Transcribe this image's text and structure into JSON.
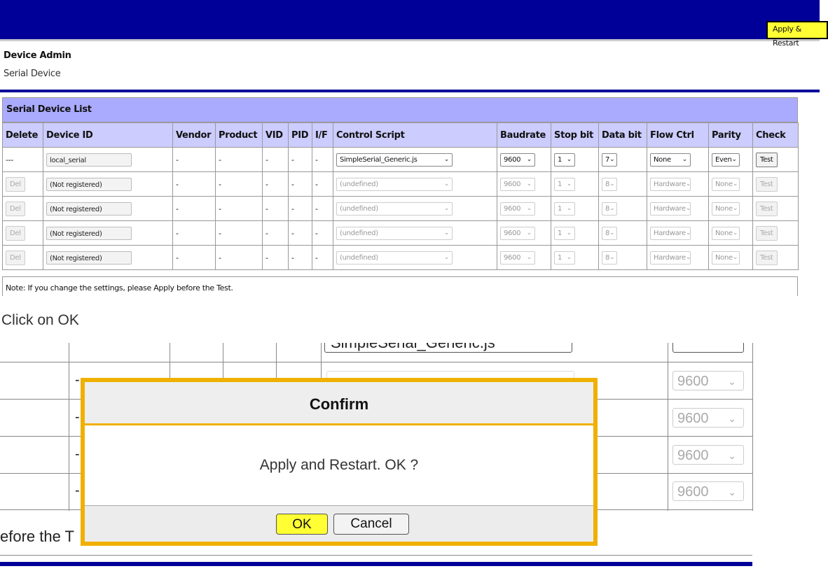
{
  "header": {
    "apply_restart_label": "Apply & Restart"
  },
  "breadcrumb": {
    "title": "Device Admin",
    "subtitle": "Serial Device"
  },
  "device_list": {
    "title": "Serial Device List",
    "columns": [
      "Delete",
      "Device ID",
      "Vendor",
      "Product",
      "VID",
      "PID",
      "I/F",
      "Control Script",
      "Baudrate",
      "Stop bit",
      "Data bit",
      "Flow Ctrl",
      "Parity",
      "Check"
    ],
    "rows": [
      {
        "delete": "---",
        "device_id": "local_serial",
        "vendor": "-",
        "product": "-",
        "vid": "-",
        "pid": "-",
        "if": "-",
        "script": "SimpleSerial_Generic.js",
        "baud": "9600",
        "stop": "1",
        "data": "7",
        "flow": "None",
        "parity": "Even",
        "check": "Test",
        "enabled": true
      },
      {
        "delete": "Del",
        "device_id": "(Not registered)",
        "vendor": "-",
        "product": "-",
        "vid": "-",
        "pid": "-",
        "if": "-",
        "script": "(undefined)",
        "baud": "9600",
        "stop": "1",
        "data": "8",
        "flow": "Hardware",
        "parity": "None",
        "check": "Test",
        "enabled": false
      },
      {
        "delete": "Del",
        "device_id": "(Not registered)",
        "vendor": "-",
        "product": "-",
        "vid": "-",
        "pid": "-",
        "if": "-",
        "script": "(undefined)",
        "baud": "9600",
        "stop": "1",
        "data": "8",
        "flow": "Hardware",
        "parity": "None",
        "check": "Test",
        "enabled": false
      },
      {
        "delete": "Del",
        "device_id": "(Not registered)",
        "vendor": "-",
        "product": "-",
        "vid": "-",
        "pid": "-",
        "if": "-",
        "script": "(undefined)",
        "baud": "9600",
        "stop": "1",
        "data": "8",
        "flow": "Hardware",
        "parity": "None",
        "check": "Test",
        "enabled": false
      },
      {
        "delete": "Del",
        "device_id": "(Not registered)",
        "vendor": "-",
        "product": "-",
        "vid": "-",
        "pid": "-",
        "if": "-",
        "script": "(undefined)",
        "baud": "9600",
        "stop": "1",
        "data": "8",
        "flow": "Hardware",
        "parity": "None",
        "check": "Test",
        "enabled": false
      }
    ],
    "note": "Note: If you change the settings, please Apply before the Test."
  },
  "instruction": "Click on OK",
  "zoom": {
    "partial_script": "SimpleSerial_Generic.js",
    "dash": "-",
    "baud_values": [
      "9600",
      "9600",
      "9600",
      "9600"
    ],
    "partial_note": "efore the T"
  },
  "dialog": {
    "title": "Confirm",
    "message": "Apply and Restart. OK ?",
    "ok_label": "OK",
    "cancel_label": "Cancel"
  },
  "colors": {
    "header_blue": "#000099",
    "highlight_yellow": "#ffff33",
    "dialog_border": "#f0b000",
    "list_title_bg": "#aaaaff"
  }
}
